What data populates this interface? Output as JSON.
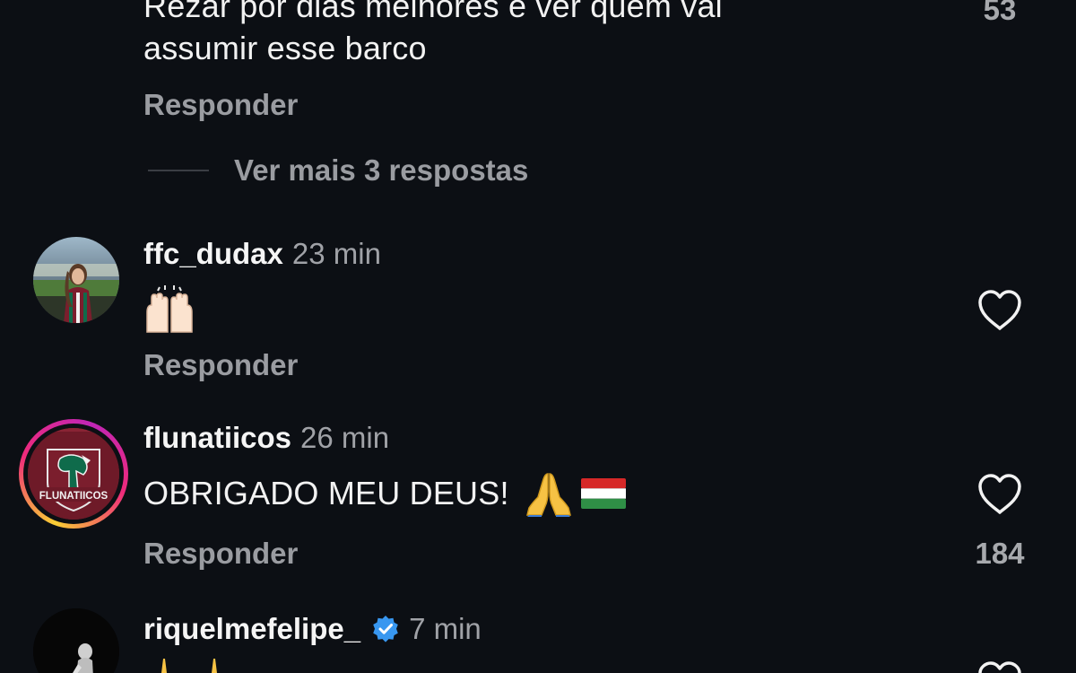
{
  "comments": [
    {
      "text": "Rezar por dias melhores e ver quem vai assumir esse barco",
      "line1": "Rezar por dias melhores e ver quem vai",
      "line2": "assumir esse barco",
      "likes": "53",
      "reply_label": "Responder",
      "more_replies": "Ver mais 3 respostas"
    },
    {
      "username": "ffc_dudax",
      "time": "23 min",
      "text_emoji": "raising-hands-emoji",
      "reply_label": "Responder"
    },
    {
      "username": "flunatiicos",
      "time": "26 min",
      "text": "OBRIGADO MEU DEUS!",
      "emojis": [
        "folded-hands-emoji",
        "flag-emoji"
      ],
      "likes": "184",
      "reply_label": "Responder",
      "avatar_label": "FLUNATIICOS"
    },
    {
      "username": "riquelmefelipe_",
      "verified": true,
      "time": "7 min"
    }
  ],
  "colors": {
    "background": "#0c0f14",
    "text": "#f5f5f5",
    "secondary": "#9a9ca1",
    "verified": "#3897f0",
    "story_ring": [
      "#f9ce34",
      "#ee2a7b",
      "#6228d7"
    ],
    "club_maroon": "#7b1e2d",
    "club_green": "#0f6b4b"
  }
}
